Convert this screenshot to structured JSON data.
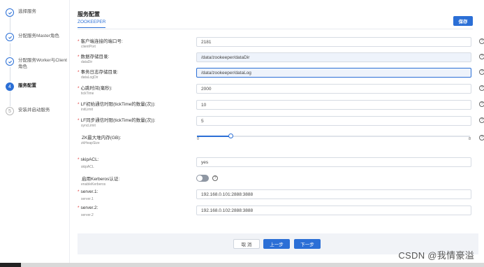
{
  "steps": [
    {
      "label": "选择服务",
      "state": "done"
    },
    {
      "label": "分配服务Master角色",
      "state": "done"
    },
    {
      "label": "分配服务Worker与Client角色",
      "state": "done"
    },
    {
      "label": "服务配置",
      "state": "active",
      "number": "4"
    },
    {
      "label": "安装并启动服务",
      "state": "todo",
      "number": "5"
    }
  ],
  "header": {
    "title": "服务配置",
    "tab": "ZOOKEEPER",
    "save_label": "保存"
  },
  "fields": {
    "clientPort": {
      "label": "客户端连接的端口号:",
      "sub": "clientPort",
      "value": "2181",
      "required": "*"
    },
    "dataDir": {
      "label": "数据存储目录:",
      "sub": "dataDir",
      "value": "/data/zookeeper/dataDir",
      "required": "*"
    },
    "dataLogDir": {
      "label": "事务日志存储目录:",
      "sub": "dataLogDir",
      "value": "/data/zookeeper/dataLog",
      "required": "*"
    },
    "tickTime": {
      "label": "心跳时间(毫秒):",
      "sub": "tickTime",
      "value": "2000",
      "required": "*"
    },
    "initLimit": {
      "label": "LF初始通信时限(tickTime的数量(次)):",
      "sub": "initLimit",
      "value": "10",
      "required": "*"
    },
    "syncLimit": {
      "label": "LF同步通信时限(tickTime的数量(次)):",
      "sub": "syncLimit",
      "value": "5",
      "required": "*"
    },
    "zkHeapSize": {
      "label": "ZK最大堆内存(GB):",
      "sub": "zkHeapSize",
      "min": "0",
      "max": "8",
      "level": 0.125
    },
    "skipACL": {
      "label": "skipACL:",
      "sub": "skipACL",
      "value": "yes",
      "required": "*"
    },
    "enableKerberos": {
      "label": "启用Kerberos认证:",
      "sub": "enableKerberos",
      "state": "off"
    },
    "server1": {
      "label": "server.1:",
      "sub": "server.1",
      "value": "192.168.0.101:2888:3888",
      "required": "*"
    },
    "server2": {
      "label": "server.2:",
      "sub": "server.2",
      "value": "192.168.0.102:2888:3888",
      "required": "*"
    }
  },
  "help_glyph": "?",
  "footer": {
    "cancel_label": "取 消",
    "prev_label": "上一步",
    "next_label": "下一步"
  },
  "watermark": "CSDN @我情豪溢",
  "icons": {
    "done": "check-circle-icon",
    "help": "question-circle-icon"
  },
  "colors": {
    "accent": "#2b6fd6",
    "required": "#e03b3b",
    "filled_bg": "#eef3fb"
  }
}
